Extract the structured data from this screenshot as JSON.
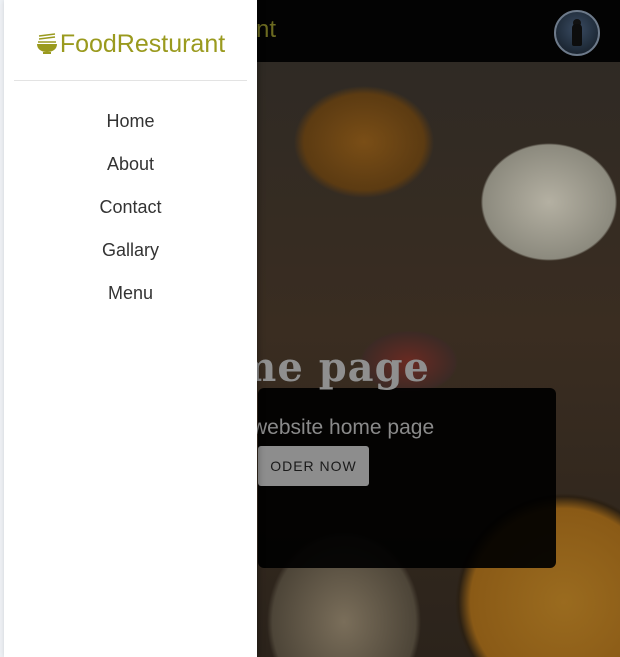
{
  "background_page": {
    "header_title_fragment": "nt",
    "hero": {
      "title_fragment": "me page",
      "subtitle_fragment": "website home page",
      "order_button_label": "ODER NOW"
    }
  },
  "drawer": {
    "brand": {
      "name": "FoodResturant",
      "icon": "bowl-noodles-icon",
      "color": "#9a9a1e"
    },
    "nav_items": [
      {
        "label": "Home"
      },
      {
        "label": "About"
      },
      {
        "label": "Contact"
      },
      {
        "label": "Gallary"
      },
      {
        "label": "Menu"
      }
    ]
  },
  "user": {
    "avatar": "user-avatar"
  }
}
